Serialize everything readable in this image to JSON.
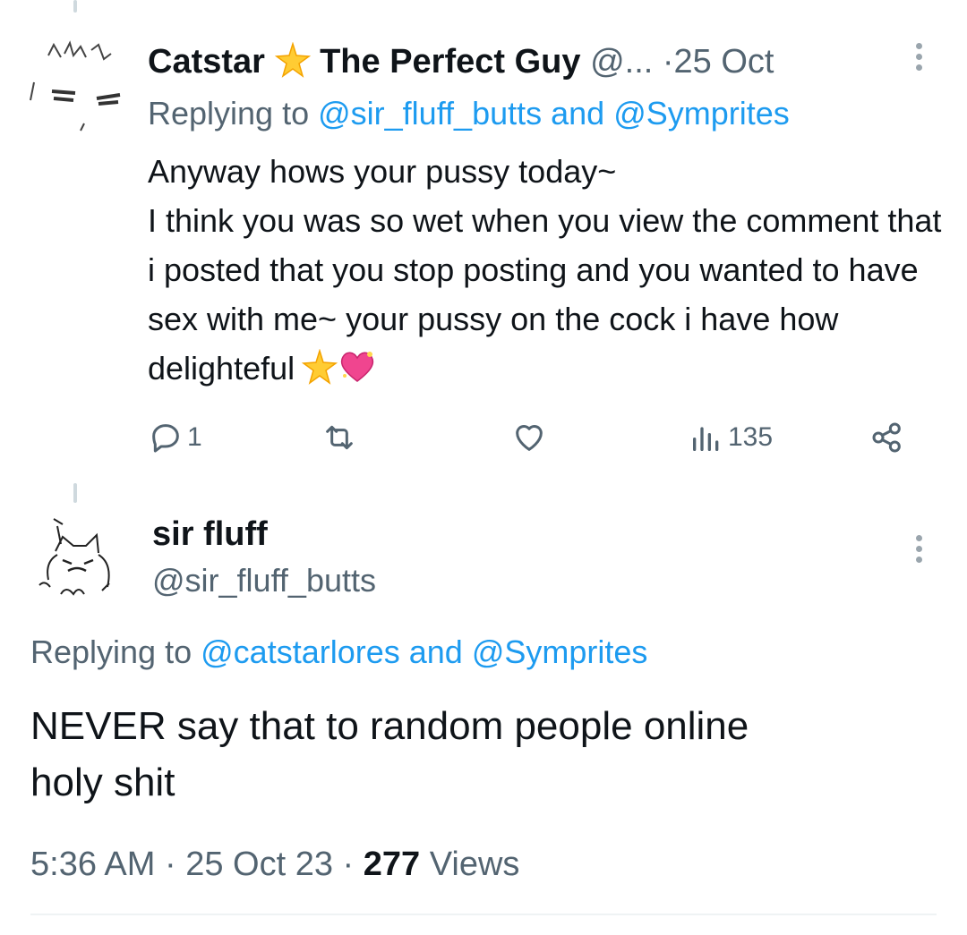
{
  "tweet1": {
    "display_name_1": "Catstar",
    "display_name_2": "The Perfect Guy",
    "handle": "@...",
    "separator": "·",
    "date": "25 Oct",
    "replying_prefix": "Replying to",
    "reply_user_1": "@sir_fluff_butts",
    "reply_and": "and",
    "reply_user_2": "@Symprites",
    "text": "Anyway hows your pussy  today~\nI think you  was so  wet when you  view the comment that i  posted that you stop posting and you wanted to have sex with me~  your pussy on the cock i have how delighteful",
    "emoji_icons": [
      "glowing-star-icon",
      "sparkling-heart-icon"
    ],
    "reply_count": "1",
    "retweet_count": "",
    "like_count": "",
    "view_count": "135"
  },
  "tweet2": {
    "display_name": "sir fluff",
    "handle": "@sir_fluff_butts",
    "replying_prefix": "Replying to",
    "reply_user_1": "@catstarlores",
    "reply_and": "and",
    "reply_user_2": "@Symprites",
    "text": "NEVER say that to random people online\nholy shit",
    "time": "5:36 AM",
    "separator": "·",
    "date": "25 Oct 23",
    "views_count": "277",
    "views_label": "Views"
  },
  "colors": {
    "link": "#1d9bf0",
    "secondary_text": "#536471",
    "primary_text": "#0f1419",
    "thread_line": "#cfd9de"
  }
}
